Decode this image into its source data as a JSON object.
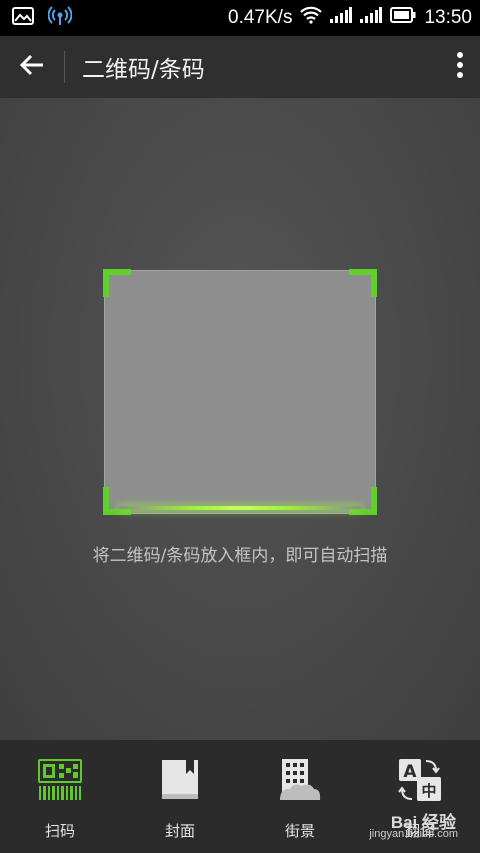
{
  "status_bar": {
    "speed": "0.47K/s",
    "time": "13:50",
    "icons": [
      "image-icon",
      "hotspot-icon",
      "wifi-icon",
      "signal-icon",
      "signal-icon-2",
      "battery-icon"
    ]
  },
  "header": {
    "title": "二维码/条码",
    "back_icon": "back-arrow-icon",
    "menu_icon": "more-vert-icon"
  },
  "scanner": {
    "hint": "将二维码/条码放入框内，即可自动扫描"
  },
  "tabs": [
    {
      "label": "扫码",
      "icon": "qr-barcode-icon",
      "active": true
    },
    {
      "label": "封面",
      "icon": "book-cover-icon",
      "active": false
    },
    {
      "label": "街景",
      "icon": "street-view-icon",
      "active": false
    },
    {
      "label": "翻译",
      "icon": "translate-icon",
      "active": false
    }
  ],
  "watermark": {
    "text": "Bai 经验",
    "url": "jingyan.baidu.com"
  },
  "colors": {
    "accent": "#5fcf2a",
    "tabbar": "#2b2b2b",
    "titlebar": "#2f2f2f"
  }
}
